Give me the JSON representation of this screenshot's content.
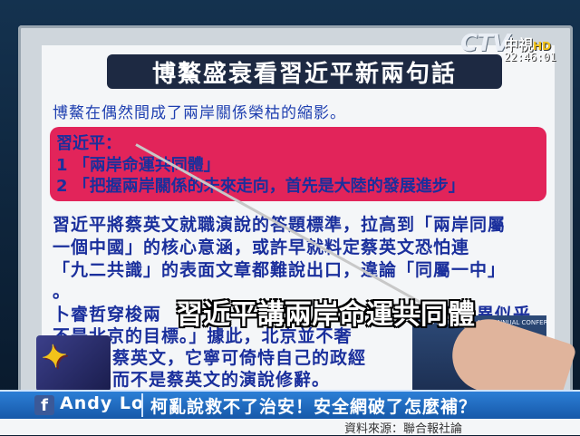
{
  "broadcast": {
    "channel_logo": "CTV",
    "channel_name": "中視",
    "hd_tag": "HD",
    "clock": "22:46:01"
  },
  "board": {
    "title": "博鰲盛衰看習近平新兩句話",
    "subtitle": "博鰲在偶然間成了兩岸關係榮枯的縮影。",
    "highlight_lines": [
      "習近平：",
      "1 「兩岸命運共同體」",
      "2 「把握兩岸關係的未來走向，首先是大陸的發展進步」"
    ],
    "body_lines": [
      "習近平將蔡英文就職演說的答題標準，拉高到「兩岸同屬",
      "一個中國」的核心意涵，或許早就料定蔡英文恐怕連",
      "「九二共識」的表面文章都難說出口，違論「同屬一中」",
      "。",
      "卜睿哲穿梭兩",
      "不是北京的目標。」據此，北京並不奢",
      "蔡英文，它寧可倚恃自己的政經",
      "而不是蔡英文的演說修辭。"
    ],
    "body_line5_tail": "同存異似乎"
  },
  "caption": "習近平講兩岸命運共同體",
  "inset_photo": {
    "banner": "BOAO FORUM FOR ASIA ANNUAL CONFERENCE"
  },
  "ticker": {
    "platform_icon": "facebook-icon",
    "name": "Andy Lo",
    "headline": "柯亂說救不了治安！安全網破了怎麼補？"
  },
  "source": "資料來源：聯合報社論"
}
